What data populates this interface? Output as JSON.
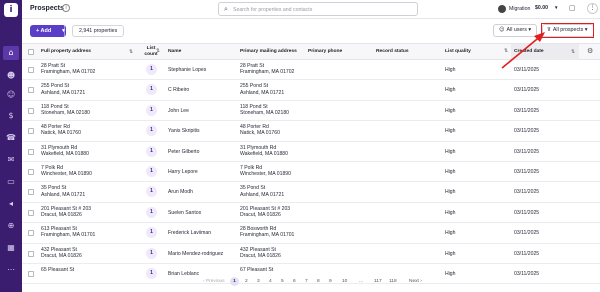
{
  "app": {
    "logo_letter": "i",
    "page_title": "Prospects"
  },
  "sidebar": {
    "items": [
      {
        "name": "sidebar-home-icon",
        "glyph": "⌂"
      },
      {
        "name": "sidebar-people-icon",
        "glyph": "☻"
      },
      {
        "name": "sidebar-contacts-icon",
        "glyph": "☺"
      },
      {
        "name": "sidebar-money-icon",
        "glyph": "$"
      },
      {
        "name": "sidebar-phone-icon",
        "glyph": "☎"
      },
      {
        "name": "sidebar-inbox-icon",
        "glyph": "✉"
      },
      {
        "name": "sidebar-mail-icon",
        "glyph": "▭"
      },
      {
        "name": "sidebar-campaign-icon",
        "glyph": "◂"
      },
      {
        "name": "sidebar-tree-icon",
        "glyph": "⊕"
      },
      {
        "name": "sidebar-grid-icon",
        "glyph": "▦"
      },
      {
        "name": "sidebar-more-icon",
        "glyph": "⋯"
      }
    ]
  },
  "header": {
    "search_placeholder": "Search for properties and contacts",
    "migration_label": "Migration",
    "credit": "$0.00"
  },
  "toolbar": {
    "add_label": "+ Add",
    "count": "2,941 properties",
    "users_label": "All users",
    "prospects_label": "All prospects"
  },
  "columns": {
    "full_address": "Full property address",
    "list_count_1": "List",
    "list_count_2": "count",
    "name": "Name",
    "mailing": "Primary mailing address",
    "phone": "Primary phone",
    "status": "Record status",
    "quality": "List quality",
    "created": "Created date"
  },
  "rows": [
    {
      "addr1": "28 Pratt St",
      "addr2": "Framingham, MA 01702",
      "count": "1",
      "name": "Stephanie Lopes",
      "mail1": "28 Pratt St",
      "mail2": "Framingham, MA 01702",
      "quality": "High",
      "created": "03/11/2025"
    },
    {
      "addr1": "255 Pond St",
      "addr2": "Ashland, MA 01721",
      "count": "1",
      "name": "C Ribeiro",
      "mail1": "255 Pond St",
      "mail2": "Ashland, MA 01721",
      "quality": "High",
      "created": "03/11/2025"
    },
    {
      "addr1": "118 Pond St",
      "addr2": "Stoneham, MA 02180",
      "count": "1",
      "name": "John Lee",
      "mail1": "118 Pond St",
      "mail2": "Stoneham, MA 02180",
      "quality": "High",
      "created": "03/11/2025"
    },
    {
      "addr1": "48 Porter Rd",
      "addr2": "Natick, MA 01760",
      "count": "1",
      "name": "Yanis Skripitis",
      "mail1": "48 Porter Rd",
      "mail2": "Natick, MA 01760",
      "quality": "High",
      "created": "03/11/2025"
    },
    {
      "addr1": "31 Plymouth Rd",
      "addr2": "Wakefield, MA 01880",
      "count": "1",
      "name": "Peter Gilberto",
      "mail1": "31 Plymouth Rd",
      "mail2": "Wakefield, MA 01880",
      "quality": "High",
      "created": "03/11/2025"
    },
    {
      "addr1": "7 Polk Rd",
      "addr2": "Winchester, MA 01890",
      "count": "1",
      "name": "Harry Lepore",
      "mail1": "7 Polk Rd",
      "mail2": "Winchester, MA 01890",
      "quality": "High",
      "created": "03/11/2025"
    },
    {
      "addr1": "35 Pond St",
      "addr2": "Ashland, MA 01721",
      "count": "1",
      "name": "Arun Modh",
      "mail1": "35 Pond St",
      "mail2": "Ashland, MA 01721",
      "quality": "High",
      "created": "03/11/2025"
    },
    {
      "addr1": "201 Pleasant St # 203",
      "addr2": "Dracut, MA 01826",
      "count": "1",
      "name": "Suelen Santos",
      "mail1": "201 Pleasant St # 203",
      "mail2": "Dracut, MA 01826",
      "quality": "High",
      "created": "03/11/2025"
    },
    {
      "addr1": "613 Pleasant St",
      "addr2": "Framingham, MA 01701",
      "count": "1",
      "name": "Frederick Laviiman",
      "mail1": "28 Bosworth Rd",
      "mail2": "Framingham, MA 01701",
      "quality": "High",
      "created": "03/11/2025"
    },
    {
      "addr1": "432 Pleasant St",
      "addr2": "Dracut, MA 01826",
      "count": "1",
      "name": "Mario Mendez-rodriguez",
      "mail1": "432 Pleasant St",
      "mail2": "Dracut, MA 01826",
      "quality": "High",
      "created": "03/11/2025"
    },
    {
      "addr1": "65 Pleasant St",
      "addr2": "",
      "count": "1",
      "name": "Brian Leblanc",
      "mail1": "67 Pleasant St",
      "mail2": "",
      "quality": "High",
      "created": "03/11/2025"
    }
  ],
  "pagination": {
    "previous": "‹ Previous",
    "pages": [
      "1",
      "2",
      "3",
      "4",
      "5",
      "6",
      "7",
      "8",
      "9",
      "10",
      "...",
      "117",
      "118"
    ],
    "next": "Next ›",
    "current": "1"
  },
  "colors": {
    "sidebar": "#3a1d6e",
    "accent": "#5b3ec7",
    "highlight": "#e21d1d"
  }
}
